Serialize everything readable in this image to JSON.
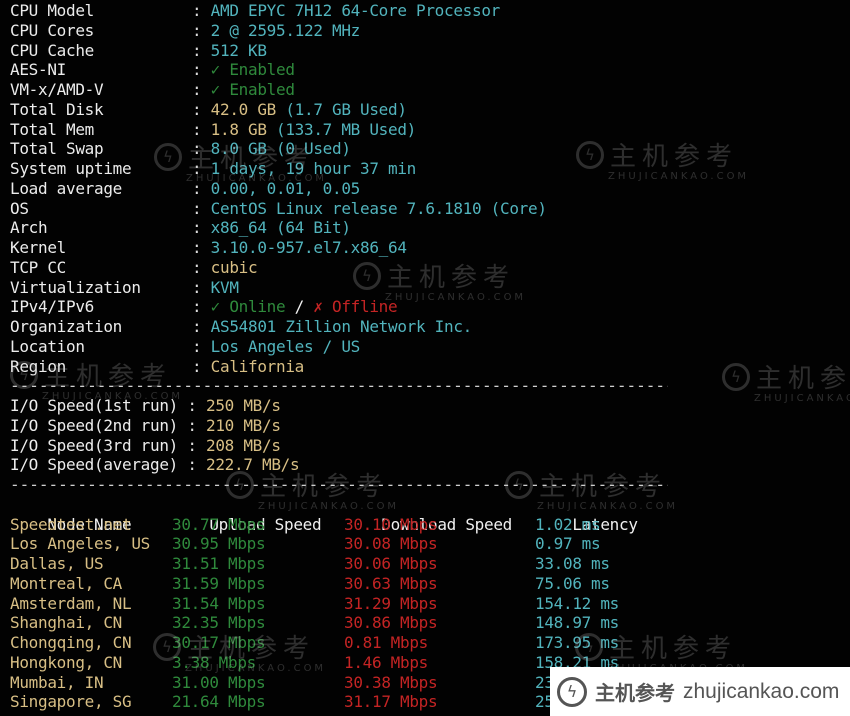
{
  "system_info": [
    {
      "label": "CPU Model",
      "parts": [
        {
          "text": "AMD EPYC 7H12 64-Core Processor",
          "color": "cyan"
        }
      ]
    },
    {
      "label": "CPU Cores",
      "parts": [
        {
          "text": "2 @ 2595.122 MHz",
          "color": "cyan"
        }
      ]
    },
    {
      "label": "CPU Cache",
      "parts": [
        {
          "text": "512 KB",
          "color": "cyan"
        }
      ]
    },
    {
      "label": "AES-NI",
      "parts": [
        {
          "text": "✓ Enabled",
          "color": "green"
        }
      ]
    },
    {
      "label": "VM-x/AMD-V",
      "parts": [
        {
          "text": "✓ Enabled",
          "color": "green"
        }
      ]
    },
    {
      "label": "Total Disk",
      "parts": [
        {
          "text": "42.0 GB",
          "color": "yellow"
        },
        {
          "text": " (1.7 GB Used)",
          "color": "cyan"
        }
      ]
    },
    {
      "label": "Total Mem",
      "parts": [
        {
          "text": "1.8 GB",
          "color": "yellow"
        },
        {
          "text": " (133.7 MB Used)",
          "color": "cyan"
        }
      ]
    },
    {
      "label": "Total Swap",
      "parts": [
        {
          "text": "8.0 GB",
          "color": "cyan"
        },
        {
          "text": " (0 Used)",
          "color": "cyan"
        }
      ]
    },
    {
      "label": "System uptime",
      "parts": [
        {
          "text": "1 days, 19 hour 37 min",
          "color": "cyan"
        }
      ]
    },
    {
      "label": "Load average",
      "parts": [
        {
          "text": "0.00, 0.01, 0.05",
          "color": "cyan"
        }
      ]
    },
    {
      "label": "OS",
      "parts": [
        {
          "text": "CentOS Linux release 7.6.1810 (Core)",
          "color": "cyan"
        }
      ]
    },
    {
      "label": "Arch",
      "parts": [
        {
          "text": "x86_64 (64 Bit)",
          "color": "cyan"
        }
      ]
    },
    {
      "label": "Kernel",
      "parts": [
        {
          "text": "3.10.0-957.el7.x86_64",
          "color": "cyan"
        }
      ]
    },
    {
      "label": "TCP CC",
      "parts": [
        {
          "text": "cubic",
          "color": "yellow"
        }
      ]
    },
    {
      "label": "Virtualization",
      "parts": [
        {
          "text": "KVM",
          "color": "cyan"
        }
      ]
    },
    {
      "label": "IPv4/IPv6",
      "parts": [
        {
          "text": "✓ Online",
          "color": "green"
        },
        {
          "text": " / ",
          "color": "white"
        },
        {
          "text": "✗ Offline",
          "color": "red"
        }
      ]
    },
    {
      "label": "Organization",
      "parts": [
        {
          "text": "AS54801 Zillion Network Inc.",
          "color": "cyan"
        }
      ]
    },
    {
      "label": "Location",
      "parts": [
        {
          "text": "Los Angeles / US",
          "color": "cyan"
        }
      ]
    },
    {
      "label": "Region",
      "parts": [
        {
          "text": "California",
          "color": "yellow"
        }
      ]
    }
  ],
  "separator": "----------------------------------------------------------------------------------",
  "io_speed": [
    {
      "label": "I/O Speed(1st run) ",
      "value": "250 MB/s"
    },
    {
      "label": "I/O Speed(2nd run) ",
      "value": "210 MB/s"
    },
    {
      "label": "I/O Speed(3rd run) ",
      "value": "208 MB/s"
    },
    {
      "label": "I/O Speed(average) ",
      "value": "222.7 MB/s"
    }
  ],
  "speedtest": {
    "headers": {
      "node": "Node Name",
      "upload": "Upload Speed",
      "download": "Download Speed",
      "latency": "Latency"
    },
    "rows": [
      {
        "node": "Speedtest.net",
        "upload": "30.77 Mbps",
        "download": "30.10 Mbps",
        "latency": "1.02 ms"
      },
      {
        "node": "Los Angeles, US",
        "upload": "30.95 Mbps",
        "download": "30.08 Mbps",
        "latency": "0.97 ms"
      },
      {
        "node": "Dallas, US",
        "upload": "31.51 Mbps",
        "download": "30.06 Mbps",
        "latency": "33.08 ms"
      },
      {
        "node": "Montreal, CA",
        "upload": "31.59 Mbps",
        "download": "30.63 Mbps",
        "latency": "75.06 ms"
      },
      {
        "node": "Amsterdam, NL",
        "upload": "31.54 Mbps",
        "download": "31.29 Mbps",
        "latency": "154.12 ms"
      },
      {
        "node": "Shanghai, CN",
        "upload": "32.35 Mbps",
        "download": "30.86 Mbps",
        "latency": "148.97 ms"
      },
      {
        "node": "Chongqing, CN",
        "upload": "30.17 Mbps",
        "download": "0.81 Mbps",
        "latency": "173.95 ms"
      },
      {
        "node": "Hongkong, CN",
        "upload": "3.38 Mbps",
        "download": "1.46 Mbps",
        "latency": "158.21 ms"
      },
      {
        "node": "Mumbai, IN",
        "upload": "31.00 Mbps",
        "download": "30.38 Mbps",
        "latency": "23"
      },
      {
        "node": "Singapore, SG",
        "upload": "21.64 Mbps",
        "download": "31.17 Mbps",
        "latency": "25"
      }
    ]
  },
  "watermark": {
    "cn": "主机参考",
    "en": "ZHUJICANKAO.COM",
    "logo_glyph": "ϟ"
  },
  "banner": {
    "cn": "主机参考",
    "en": "zhujicankao.com",
    "logo_glyph": "ϟ"
  },
  "colon": ": "
}
